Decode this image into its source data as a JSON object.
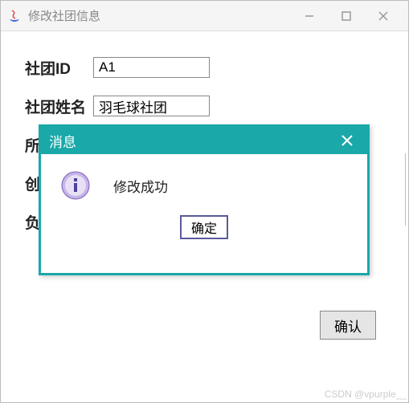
{
  "window": {
    "title": "修改社团信息"
  },
  "form": {
    "fields": [
      {
        "label": "社团ID",
        "value": "A1"
      },
      {
        "label": "社团姓名",
        "value": "羽毛球社团"
      },
      {
        "label": "所",
        "value": ""
      },
      {
        "label": "创",
        "value": ""
      },
      {
        "label": "负",
        "value": ""
      }
    ],
    "confirm_label": "确认"
  },
  "dialog": {
    "title": "消息",
    "message": "修改成功",
    "ok_label": "确定"
  },
  "watermark": "CSDN @vpurple__"
}
